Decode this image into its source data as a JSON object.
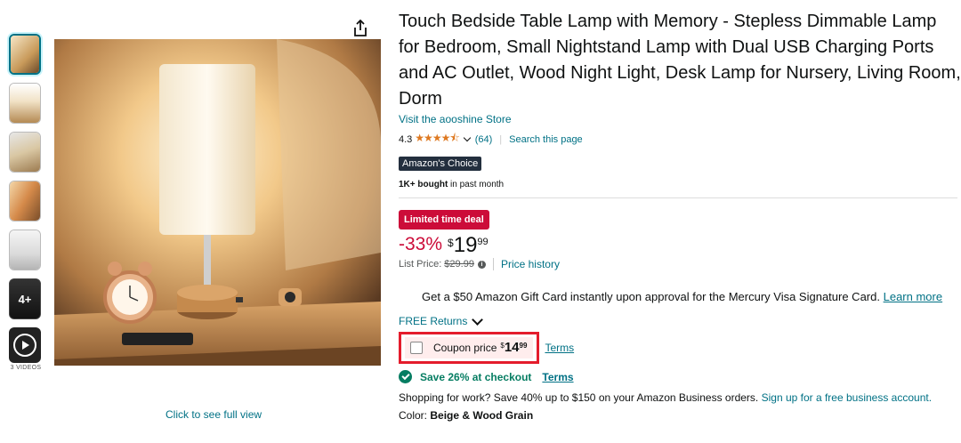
{
  "gallery": {
    "more_count": "4+",
    "videos_label": "3 VIDEOS",
    "full_view_label": "Click to see full view"
  },
  "product": {
    "title": "Touch Bedside Table Lamp with Memory - Stepless Dimmable Lamp for Bedroom, Small Nightstand Lamp with Dual USB Charging Ports and AC Outlet, Wood Night Light, Desk Lamp for Nursery, Living Room, Dorm",
    "store_link": "Visit the aooshine Store",
    "rating": "4.3",
    "rating_value": 4.3,
    "stars": "★★★★⯪",
    "review_count": "(64)",
    "search_page": "Search this page",
    "choice_badge": "Amazon's Choice",
    "bought_bold": "1K+ bought",
    "bought_rest": " in past month"
  },
  "pricing": {
    "deal_badge": "Limited time deal",
    "discount": "-33%",
    "currency": "$",
    "price_whole": "19",
    "price_fraction": "99",
    "list_price_label": "List Price:",
    "list_price": "$29.99",
    "price_history": "Price history"
  },
  "offers": {
    "gift_text": "Get a $50 Amazon Gift Card instantly upon approval for the Mercury Visa Signature Card.",
    "gift_link": "Learn more",
    "returns": "FREE Returns",
    "coupon_label": "Coupon price",
    "coupon_currency": "$",
    "coupon_whole": "14",
    "coupon_fraction": "99",
    "coupon_terms": "Terms",
    "save_text": "Save 26% at checkout",
    "save_terms": "Terms",
    "business_text": "Shopping for work? Save 40% up to $150 on your Amazon Business orders.",
    "business_link": "Sign up for a free business account.",
    "color_label": "Color:",
    "color_value": "Beige & Wood Grain"
  },
  "colors": {
    "link": "#007185",
    "deal_red": "#cc0c39",
    "coupon_border": "#e41c2c",
    "star": "#de7921",
    "save_green": "#067d62"
  }
}
